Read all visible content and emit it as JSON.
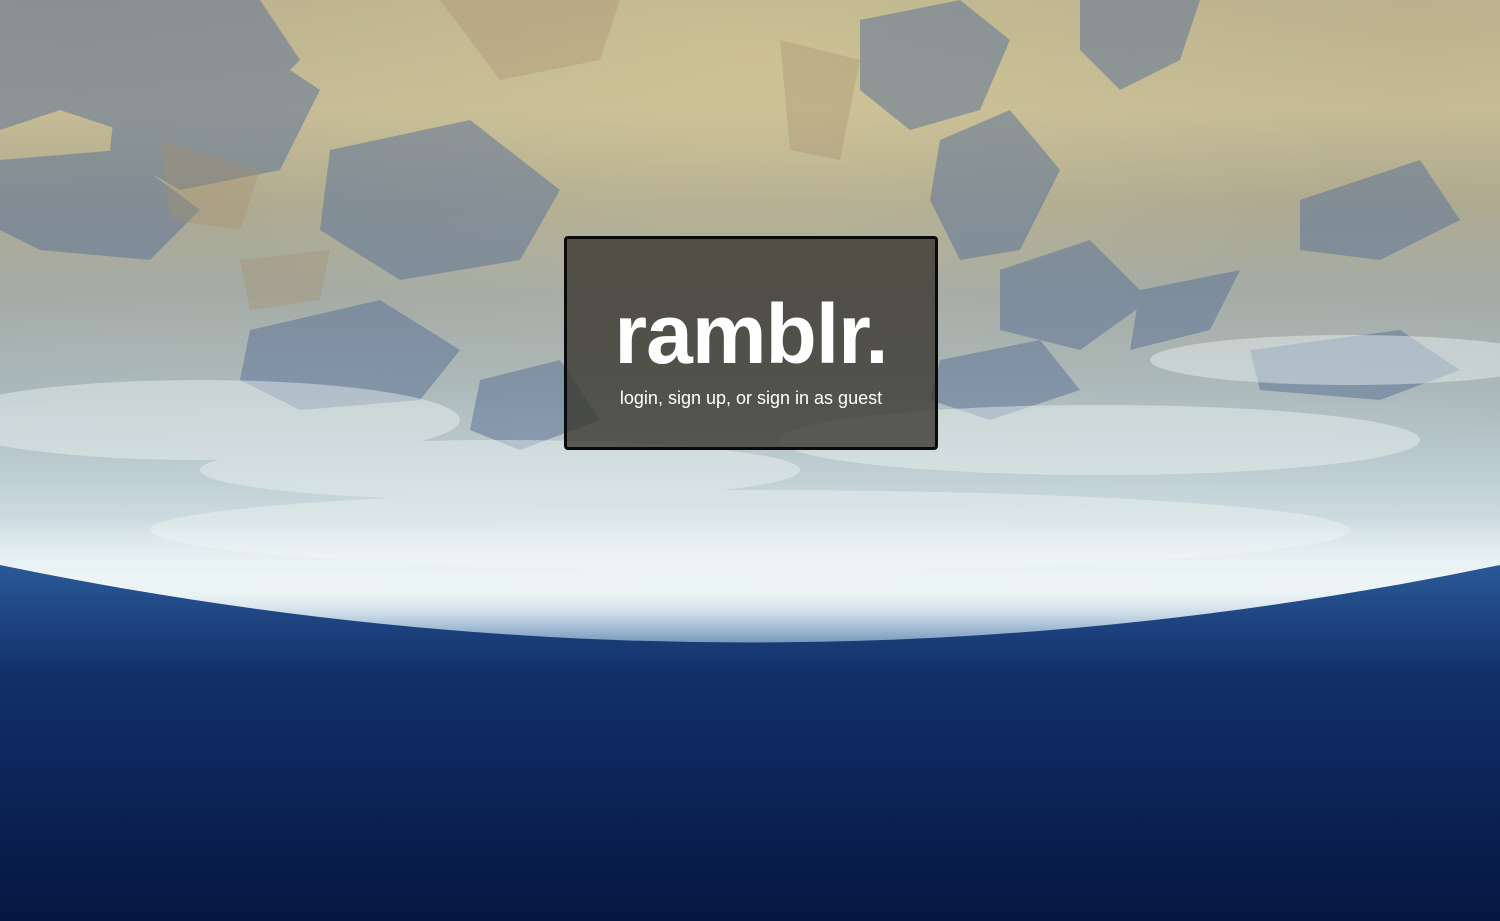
{
  "brand": {
    "title": "ramblr."
  },
  "auth": {
    "login_label": "login",
    "sep1": ", ",
    "signup_label": "sign up",
    "sep2": ", or ",
    "guest_label": "sign in as guest"
  },
  "colors": {
    "land_tan": "#c4b98f",
    "mountain_blue": "#6b7f9c",
    "cloud_white": "#e2eef0",
    "ocean_deep": "#0d2557",
    "card_bg": "rgba(55,52,45,0.78)"
  }
}
